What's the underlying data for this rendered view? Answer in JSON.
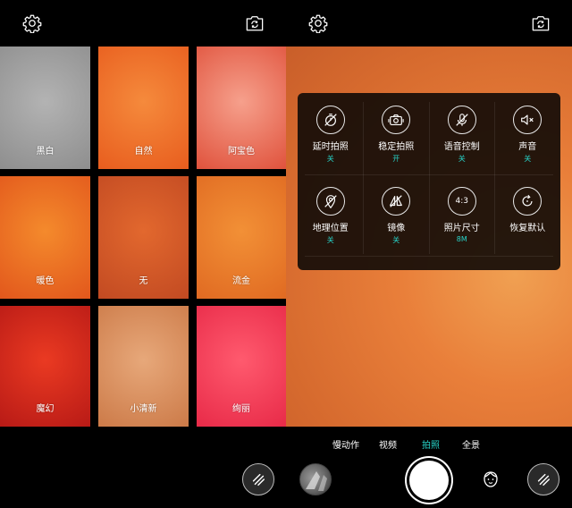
{
  "left_screen": {
    "icons": {
      "settings": "gear-icon",
      "switch_camera": "camera-switch-icon"
    },
    "filters": [
      {
        "label": "黑白",
        "colors": [
          "#b3b3b3",
          "#8e8e8e"
        ]
      },
      {
        "label": "自然",
        "colors": [
          "#f58a3c",
          "#e85d1e"
        ]
      },
      {
        "label": "阿宝色",
        "colors": [
          "#f6a08c",
          "#e0523c"
        ]
      },
      {
        "label": "暖色",
        "colors": [
          "#f48a2c",
          "#e2571c"
        ]
      },
      {
        "label": "无",
        "colors": [
          "#e2682e",
          "#c24a22"
        ]
      },
      {
        "label": "流金",
        "colors": [
          "#f29036",
          "#e06a22"
        ]
      },
      {
        "label": "魔幻",
        "colors": [
          "#ea3a22",
          "#b81a16"
        ]
      },
      {
        "label": "小清新",
        "colors": [
          "#e7a87a",
          "#cc7a48"
        ]
      },
      {
        "label": "绚丽",
        "colors": [
          "#ff5a6e",
          "#e82a48"
        ]
      }
    ]
  },
  "right_screen": {
    "icons": {
      "settings": "gear-icon",
      "switch_camera": "camera-switch-icon"
    },
    "settings_panel": [
      {
        "label": "延时拍照",
        "value": "关",
        "icon": "timer-off-icon"
      },
      {
        "label": "稳定拍照",
        "value": "开",
        "icon": "camera-stable-icon"
      },
      {
        "label": "语音控制",
        "value": "关",
        "icon": "mic-off-icon"
      },
      {
        "label": "声音",
        "value": "关",
        "icon": "speaker-mute-icon"
      },
      {
        "label": "地理位置",
        "value": "关",
        "icon": "location-off-icon"
      },
      {
        "label": "镜像",
        "value": "关",
        "icon": "mirror-off-icon"
      },
      {
        "label": "照片尺寸",
        "value": "8M",
        "icon": "aspect-ratio-icon",
        "icon_text": "4:3"
      },
      {
        "label": "恢复默认",
        "value": "",
        "icon": "restore-icon"
      }
    ],
    "modes": [
      "慢动作",
      "视频",
      "拍照",
      "全景"
    ],
    "active_mode": "拍照"
  },
  "colors": {
    "accent": "#27d3c8",
    "panel_bg": "#140c08",
    "preview": "#e97f3a"
  }
}
